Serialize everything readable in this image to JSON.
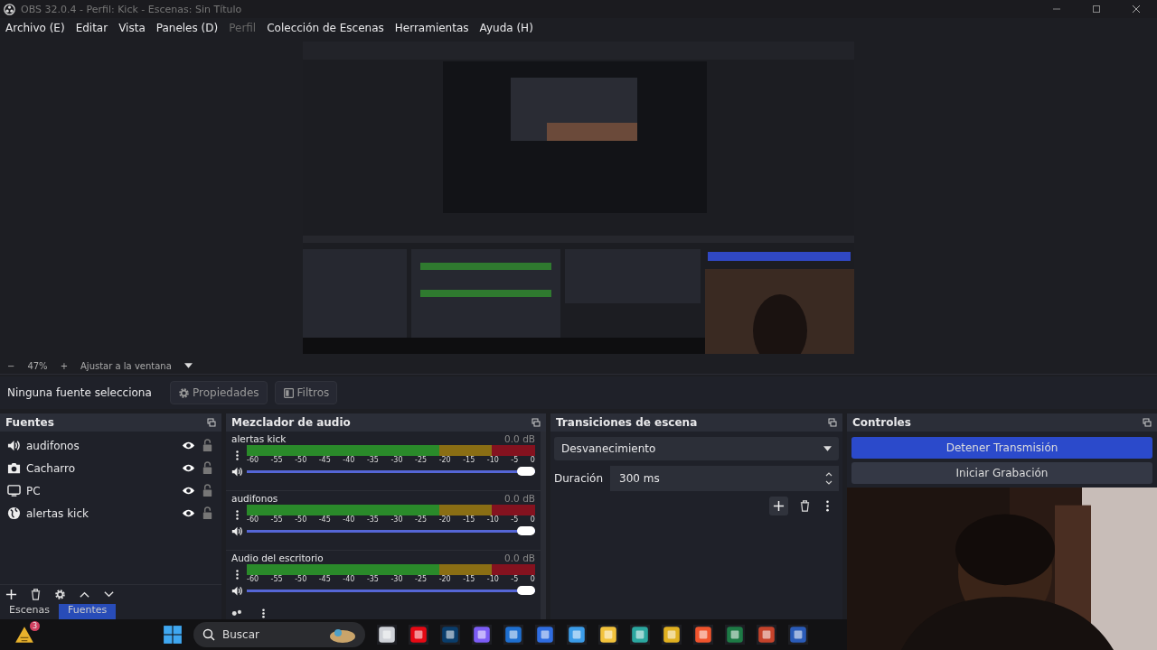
{
  "window": {
    "title": "OBS 32.0.4 - Perfil: Kick - Escenas: Sin Título"
  },
  "menu": [
    {
      "label": "Archivo (E)",
      "disabled": false
    },
    {
      "label": "Editar",
      "disabled": false
    },
    {
      "label": "Vista",
      "disabled": false
    },
    {
      "label": "Paneles (D)",
      "disabled": false
    },
    {
      "label": "Perfil",
      "disabled": true
    },
    {
      "label": "Colección de Escenas",
      "disabled": false
    },
    {
      "label": "Herramientas",
      "disabled": false
    },
    {
      "label": "Ayuda (H)",
      "disabled": false
    }
  ],
  "zoom_bar": {
    "minus": "−",
    "zoom": "47%",
    "plus": "+",
    "fit": "Ajustar a la ventana"
  },
  "context_bar": {
    "status": "Ninguna fuente selecciona",
    "buttons": [
      {
        "label": "Propiedades",
        "kind": "gear"
      },
      {
        "label": "Filtros",
        "kind": "filter"
      }
    ]
  },
  "sources": {
    "title": "Fuentes",
    "items": [
      {
        "name": "audifonos",
        "kind": "audio",
        "visible": true,
        "locked": false
      },
      {
        "name": "Cacharro",
        "kind": "camera",
        "visible": true,
        "locked": false
      },
      {
        "name": "PC",
        "kind": "display",
        "visible": true,
        "locked": false
      },
      {
        "name": "alertas kick",
        "kind": "browser",
        "visible": true,
        "locked": false
      }
    ]
  },
  "dock_tabs": [
    {
      "label": "Escenas",
      "selected": false
    },
    {
      "label": "Fuentes",
      "selected": true
    }
  ],
  "mixer": {
    "title": "Mezclador de audio",
    "channels": [
      {
        "name": "alertas kick",
        "reading": "0.0 dB",
        "muted": false,
        "level": 1,
        "scale": [
          "-60",
          "-55",
          "-50",
          "-45",
          "-40",
          "-35",
          "-30",
          "-25",
          "-20",
          "-15",
          "-10",
          "-5",
          "0"
        ]
      },
      {
        "name": "audifonos",
        "reading": "0.0 dB",
        "muted": false,
        "level": 1,
        "scale": [
          "-60",
          "-55",
          "-50",
          "-45",
          "-40",
          "-35",
          "-30",
          "-25",
          "-20",
          "-15",
          "-10",
          "-5",
          "0"
        ]
      },
      {
        "name": "Audio del escritorio",
        "reading": "0.0 dB",
        "muted": false,
        "level": 1,
        "scale": [
          "-60",
          "-55",
          "-50",
          "-45",
          "-40",
          "-35",
          "-30",
          "-25",
          "-20",
          "-15",
          "-10",
          "-5",
          "0"
        ]
      }
    ]
  },
  "transitions": {
    "title": "Transiciones de escena",
    "selected": "Desvanecimiento",
    "duration_label": "Duración",
    "duration": "300 ms"
  },
  "controls": {
    "title": "Controles",
    "buttons": [
      {
        "label": "Detener Transmisión",
        "active": true
      },
      {
        "label": "Iniciar Grabación",
        "active": false
      }
    ]
  },
  "taskbar": {
    "search": "Buscar",
    "badge": "3"
  }
}
